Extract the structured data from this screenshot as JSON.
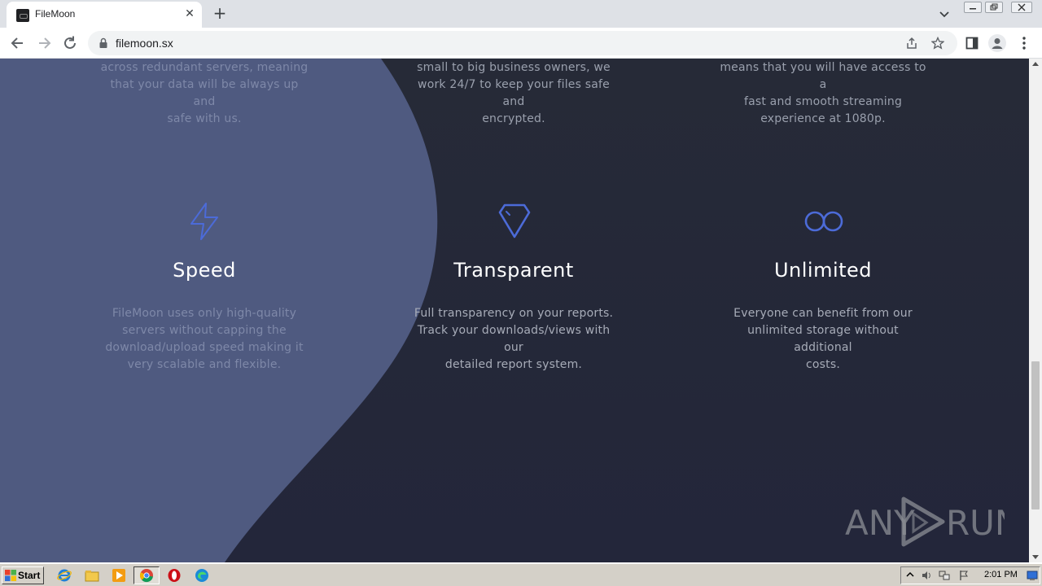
{
  "browser": {
    "tab_title": "FileMoon",
    "url": "filemoon.sx"
  },
  "page": {
    "top_texts": [
      [
        "across redundant servers, meaning",
        "that your data will be always up and",
        "safe with us."
      ],
      [
        "small to big business owners, we",
        "work 24/7 to keep your files safe and",
        "encrypted."
      ],
      [
        "means that you will have access to a",
        "fast and smooth streaming",
        "experience at 1080p."
      ]
    ],
    "features": [
      {
        "icon": "lightning-icon",
        "title": "Speed",
        "desc": [
          "FileMoon uses only high-quality",
          "servers without capping the",
          "download/upload speed making it",
          "very scalable and flexible."
        ]
      },
      {
        "icon": "diamond-icon",
        "title": "Transparent",
        "desc": [
          "Full transparency on your reports.",
          "Track your downloads/views with our",
          "detailed report system."
        ]
      },
      {
        "icon": "infinity-icon",
        "title": "Unlimited",
        "desc": [
          "Everyone can benefit from our",
          "unlimited storage without additional",
          "costs."
        ]
      }
    ],
    "colors": {
      "background": "#262a37",
      "curve": "#4f5a80",
      "accent_icon": "#4c6bd8"
    },
    "watermark": {
      "left": "ANY",
      "right": "RUN"
    }
  },
  "taskbar": {
    "start_label": "Start",
    "clock": "2:01 PM"
  }
}
